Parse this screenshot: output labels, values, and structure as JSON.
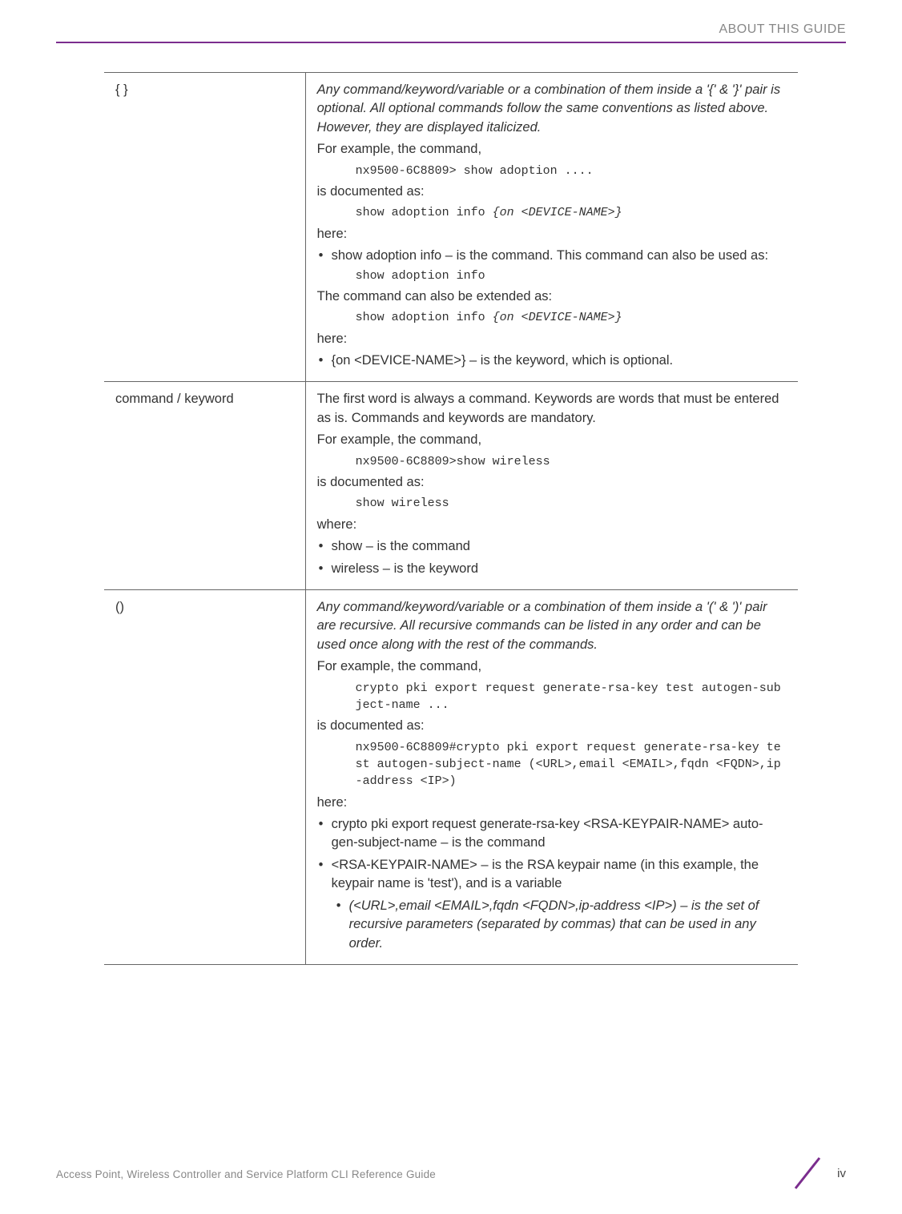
{
  "header": {
    "title": "ABOUT THIS GUIDE"
  },
  "rows": [
    {
      "symbol": "{ }",
      "p1": "Any command/keyword/variable or a combination of them inside a '{' & '}' pair is optional. All optional commands follow the same conventions as listed above. However, they are displayed italicized.",
      "p2": "For example, the command,",
      "code1": "nx9500-6C8809> show adoption ....",
      "p3": "is documented as:",
      "code2_a": "show adoption info ",
      "code2_b": "{on <DEVICE-NAME>}",
      "p4": "here:",
      "b1": "show adoption info – is the command. This command can also be used as:",
      "code3": "show adoption info",
      "p5": "The command can also be extended as:",
      "code4_a": "show adoption info ",
      "code4_b": "{on <DEVICE-NAME>}",
      "p6": "here:",
      "b2": "{on <DEVICE-NAME>} – is the keyword, which is optional."
    },
    {
      "symbol": "command / keyword",
      "p1": "The first word is always a command. Keywords are words that must be entered as is. Commands and keywords are mandatory.",
      "p2": "For example, the command,",
      "code1": "nx9500-6C8809>show wireless",
      "p3": "is documented as:",
      "code2": "show wireless",
      "p4": "where:",
      "b1": "show – is the command",
      "b2": "wireless – is the keyword"
    },
    {
      "symbol": "()",
      "p1": "Any command/keyword/variable or a combination of them inside a '(' & ')' pair are recursive. All recursive commands can be listed in any order and can be used once along with the rest of the commands.",
      "p2": "For example, the command,",
      "code1": "crypto pki export request generate-rsa-key test autogen-subject-name ...",
      "p3": "is documented as:",
      "code2": "nx9500-6C8809#crypto pki export request generate-rsa-key test autogen-subject-name (<URL>,email <EMAIL>,fqdn <FQDN>,ip-address <IP>)",
      "p4": "here:",
      "b1": "crypto pki export request generate-rsa-key <RSA-KEYPAIR-NAME> auto-gen-subject-name – is the command",
      "b2": "<RSA-KEYPAIR-NAME> – is the RSA keypair name (in this example, the keypair name is 'test'), and is a variable",
      "sub1": "(<URL>,email <EMAIL>,fqdn <FQDN>,ip-address <IP>) – is the set of recursive parameters (separated by commas) that can be used in any order."
    }
  ],
  "footer": {
    "text": "Access Point, Wireless Controller and Service Platform CLI Reference Guide",
    "page": "iv"
  }
}
